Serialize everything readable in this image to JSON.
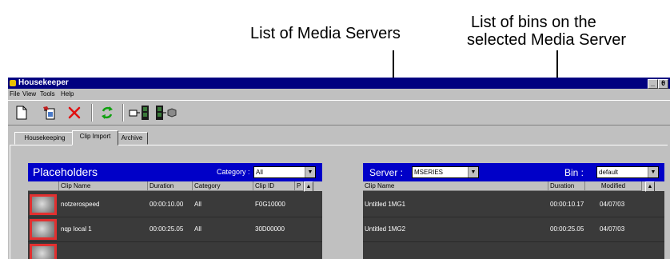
{
  "callouts": {
    "media_servers": "List of Media Servers",
    "bins_line1": "List of bins on the",
    "bins_line2": "selected Media Server"
  },
  "window": {
    "title": "Housekeeper",
    "controls": [
      "_",
      "θ"
    ]
  },
  "menu": [
    "File",
    "View",
    "Tools",
    "Help"
  ],
  "toolbar": {
    "buttons": [
      "new-document-icon",
      "save-placeholder-icon",
      "delete-icon",
      "refresh-icon",
      "import-clip-icon",
      "export-clip-icon"
    ]
  },
  "tabs": [
    "Housekeeping",
    "Clip Import",
    "Archive"
  ],
  "active_tab": "Clip Import",
  "placeholders": {
    "title": "Placeholders",
    "category_label": "Category :",
    "category_value": "All",
    "columns": [
      "Clip Name",
      "Duration",
      "Category",
      "Clip ID",
      "P"
    ],
    "rows": [
      {
        "name": "notzerospeed",
        "duration": "00:00:10.00",
        "category": "All",
        "clip_id": "F0G10000"
      },
      {
        "name": "nqp local 1",
        "duration": "00:00:25.05",
        "category": "All",
        "clip_id": "30D00000"
      }
    ]
  },
  "media_server": {
    "server_label": "Server :",
    "server_value": "MSERIES",
    "bin_label": "Bin :",
    "bin_value": "default",
    "columns": [
      "Clip Name",
      "Duration",
      "Modified"
    ],
    "rows": [
      {
        "name": "Untitled 1MG1",
        "duration": "00:00:10.17",
        "modified": "04/07/03"
      },
      {
        "name": "Untitled 1MG2",
        "duration": "00:00:25.05",
        "modified": "04/07/03"
      }
    ]
  },
  "colors": {
    "title_bar": "#000080",
    "panel_header": "#0000c8",
    "grid_background": "#3a3a3a",
    "thumbnail_border": "#e23030"
  }
}
